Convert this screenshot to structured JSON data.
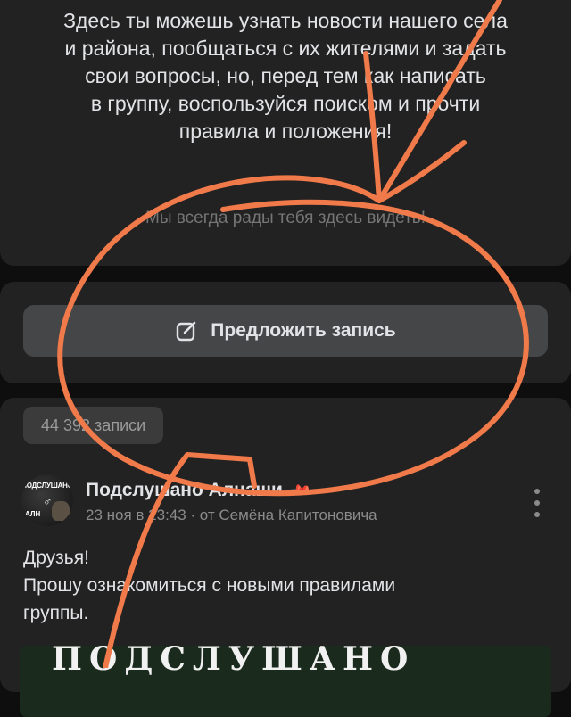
{
  "about": {
    "lines": [
      "Здесь ты можешь узнать новости нашего села",
      "и района, пообщаться с их жителями и задать",
      "свои вопросы, но, перед тем как написать",
      "в группу, воспользуйся поиском и прочти",
      "правила и положения!"
    ],
    "tagline": "Мы всегда рады тебя здесь видеть!"
  },
  "suggest": {
    "label": "Предложить запись",
    "icon": "edit-icon"
  },
  "feed": {
    "posts_count": "44 392 записи",
    "post": {
      "avatar_text": "ПОДСЛУШАНО",
      "avatar_sub": "АЛН",
      "author": "Подслушано Алнаши",
      "pinned_icon": "pin-icon",
      "meta": "23 ноя в 23:43 · от Семёна Капитоновича",
      "text_lines": [
        "Друзья!",
        "Прошу ознакомиться с новыми правилами",
        "группы."
      ],
      "image_title": "ПОДСЛУШАНО"
    }
  },
  "colors": {
    "background": "#0e0e0e",
    "card": "#222222",
    "button": "#454647",
    "annotation": "#f07a4a"
  }
}
